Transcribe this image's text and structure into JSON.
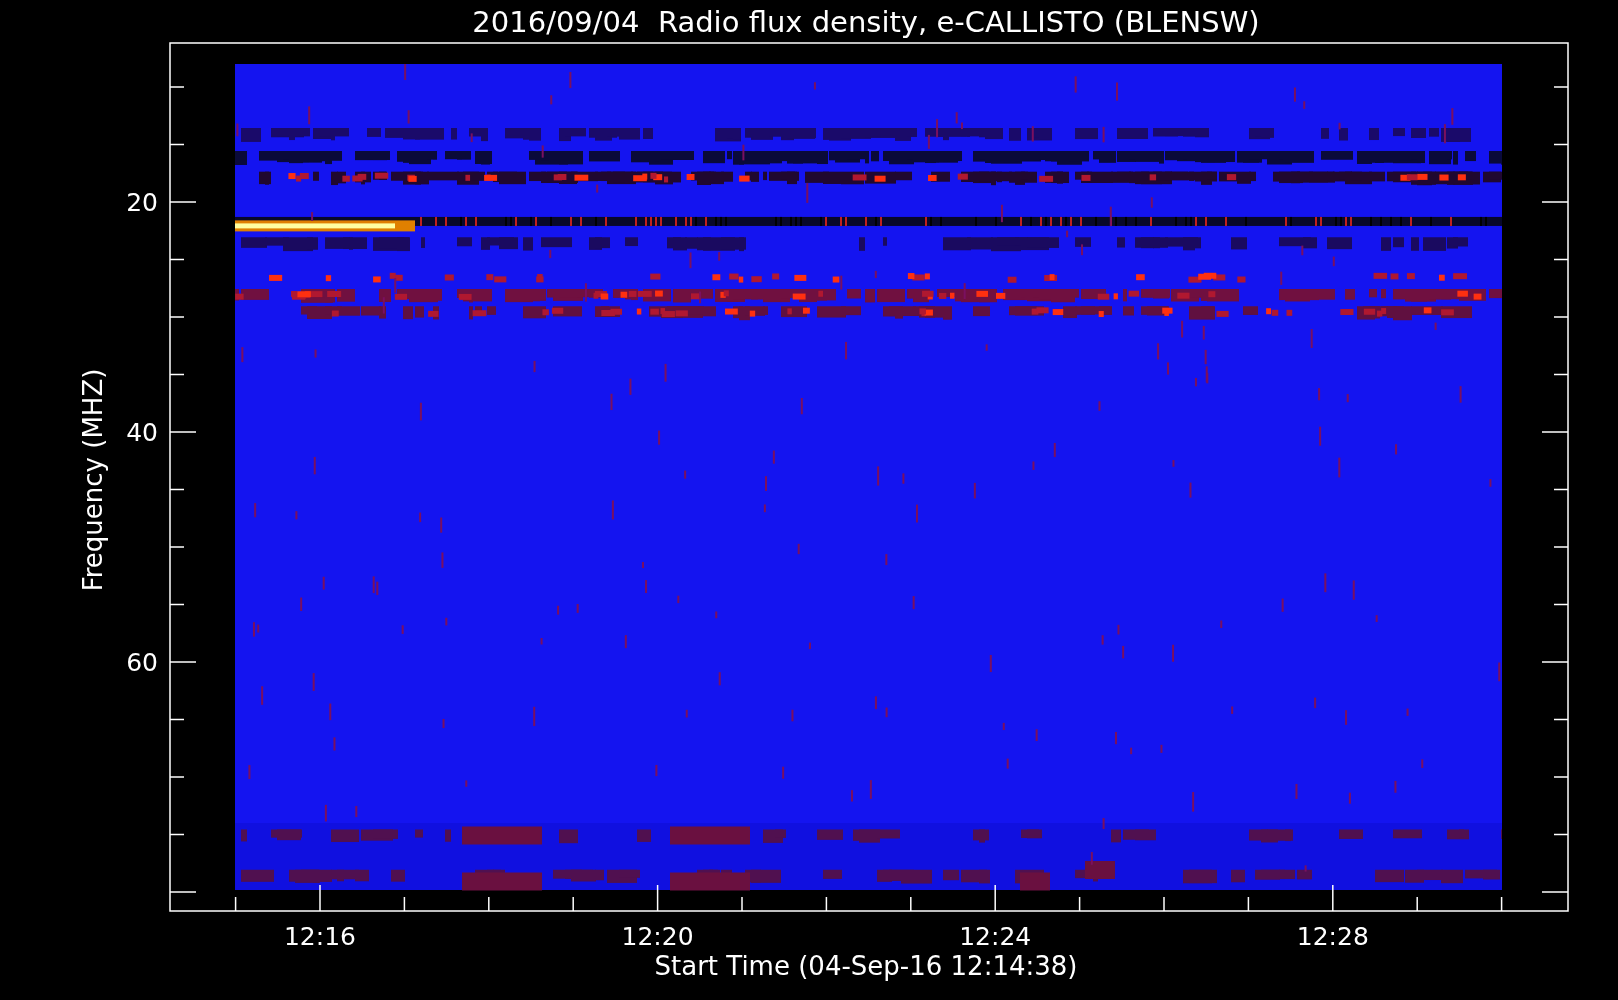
{
  "plot": {
    "title": "2016/09/04  Radio flux density, e-CALLISTO (BLENSW)",
    "xlabel": "Start Time (04-Sep-16 12:14:38)",
    "ylabel": "Frequency (MHZ)",
    "yticks": [
      "20",
      "40",
      "60"
    ],
    "xticks": [
      "12:16",
      "12:20",
      "12:24",
      "12:28"
    ]
  }
}
